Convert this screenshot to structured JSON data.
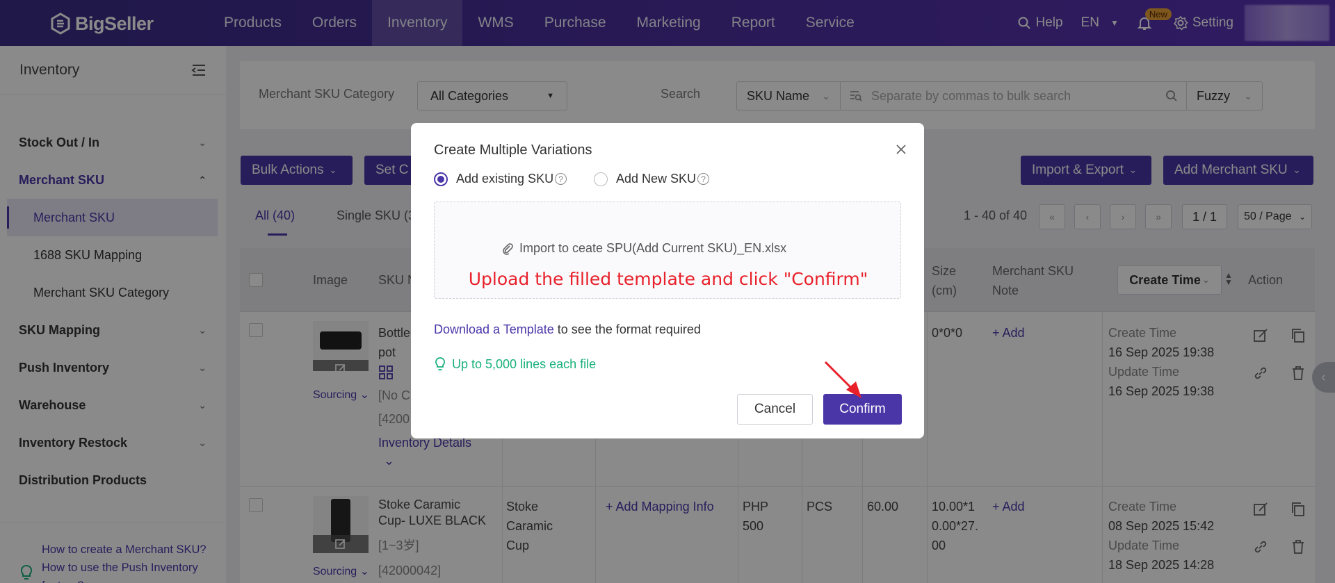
{
  "app": {
    "logo_text": "BigSeller"
  },
  "topnav": {
    "items": [
      "Products",
      "Orders",
      "Inventory",
      "WMS",
      "Purchase",
      "Marketing",
      "Report",
      "Service"
    ],
    "active": "Inventory",
    "help_label": "Help",
    "lang_label": "EN",
    "new_badge": "New",
    "setting_label": "Setting"
  },
  "sidebar": {
    "title": "Inventory",
    "items": [
      {
        "label": "Stock Out / In"
      },
      {
        "label": "Merchant SKU"
      },
      {
        "label": "Merchant SKU"
      },
      {
        "label": "1688 SKU Mapping"
      },
      {
        "label": "Merchant SKU Category"
      },
      {
        "label": "SKU Mapping"
      },
      {
        "label": "Push Inventory"
      },
      {
        "label": "Warehouse"
      },
      {
        "label": "Inventory Restock"
      },
      {
        "label": "Distribution Products"
      }
    ],
    "help_links": [
      "How to create a Merchant SKU?",
      "How to use the Push Inventory feature?"
    ]
  },
  "filter": {
    "category_label": "Merchant SKU Category",
    "category_value": "All Categories",
    "search_label": "Search",
    "search_type": "SKU Name",
    "search_placeholder": "Separate by commas to bulk search",
    "match_mode": "Fuzzy"
  },
  "toolbar": {
    "bulk_actions": "Bulk Actions",
    "set_c": "Set C",
    "import_export": "Import & Export",
    "add_merchant_sku": "Add Merchant SKU"
  },
  "tabs": {
    "all": "All (40)",
    "single": "Single SKU (3"
  },
  "pagination": {
    "range": "1 - 40 of 40",
    "page": "1 / 1",
    "per_page": "50 / Page"
  },
  "table": {
    "headers": {
      "image": "Image",
      "sku_n": "SKU N",
      "size": "Size (cm)",
      "note": "Merchant SKU Note",
      "create_time": "Create Time",
      "action": "Action"
    },
    "rows": [
      {
        "name_line1": "Bottle",
        "name_line2": "pot",
        "tag": "[No C",
        "code": "[4200",
        "sourcing": "Sourcing",
        "inventory_details": "Inventory Details",
        "size": "0*0*0",
        "note_add": "+ Add",
        "create_label": "Create Time",
        "create_time": "16 Sep 2025 19:38",
        "update_label": "Update Time",
        "update_time": "16 Sep 2025 19:38"
      },
      {
        "name_line1": "Stoke Caramic",
        "name_line2": "Cup- LUXE BLACK",
        "tag": "[1~3岁]",
        "code": "[42000042]",
        "sourcing": "Sourcing",
        "product_line1": "Stoke",
        "product_line2": "Caramic",
        "product_line3": "Cup",
        "mapping": "+ Add Mapping Info",
        "price_line1": "PHP",
        "price_line2": "500",
        "unit": "PCS",
        "weight": "60.00",
        "size_line1": "10.00*1",
        "size_line2": "0.00*27.",
        "size_line3": "00",
        "note_add": "+ Add",
        "create_label": "Create Time",
        "create_time": "08 Sep 2025 15:42",
        "update_label": "Update Time",
        "update_time": "18 Sep 2025 14:28"
      }
    ]
  },
  "modal": {
    "title": "Create Multiple Variations",
    "option_existing": "Add existing SKU",
    "option_new": "Add New SKU",
    "selected": "Add existing SKU",
    "file_name": "Import to ceate SPU(Add Current SKU)_EN.xlsx",
    "upload_instruction": "Upload the filled template and click \"Confirm\"",
    "download_link": "Download a Template",
    "download_suffix": "to see the format required",
    "tip": "Up to 5,000 lines each file",
    "cancel": "Cancel",
    "confirm": "Confirm"
  },
  "colors": {
    "brand": "#4b36a8",
    "annotation_red": "#e8202a",
    "tip_green": "#18b07b"
  }
}
